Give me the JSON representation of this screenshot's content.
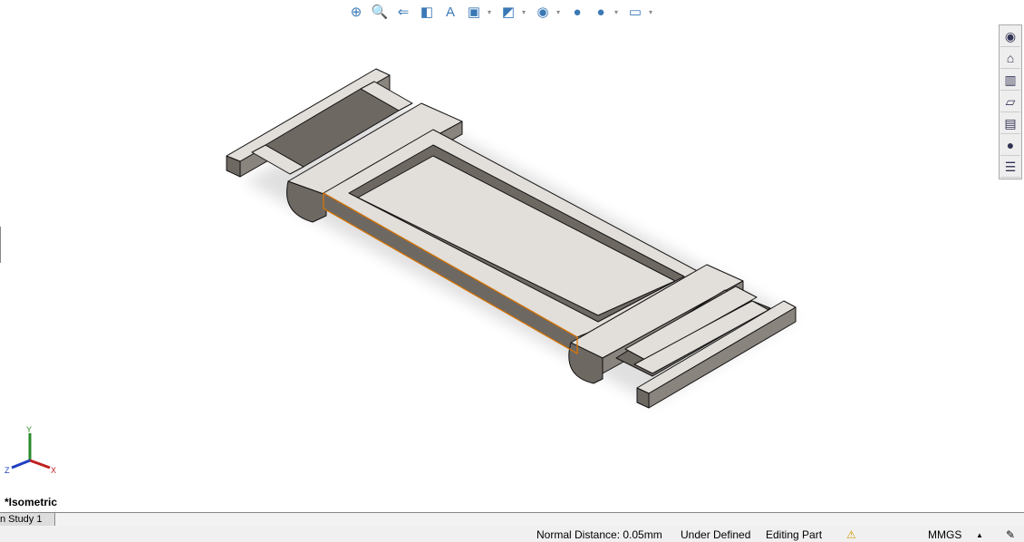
{
  "hud_toolbar": {
    "items": [
      {
        "icon": "zoom-to-fit-icon",
        "glyph": "⊕"
      },
      {
        "icon": "zoom-to-area-icon",
        "glyph": "🔍"
      },
      {
        "icon": "previous-view-icon",
        "glyph": "⇐"
      },
      {
        "icon": "section-view-icon",
        "glyph": "◧"
      },
      {
        "icon": "dynamic-annotation-icon",
        "glyph": "A"
      },
      {
        "icon": "view-orientation-icon",
        "glyph": "▣",
        "dropdown": true
      },
      {
        "icon": "display-style-icon",
        "glyph": "◩",
        "dropdown": true
      },
      {
        "icon": "hide-show-items-icon",
        "glyph": "◉",
        "dropdown": true
      },
      {
        "icon": "edit-appearance-icon",
        "glyph": "●"
      },
      {
        "icon": "apply-scene-icon",
        "glyph": "●",
        "dropdown": true
      },
      {
        "icon": "view-settings-icon",
        "glyph": "▭",
        "dropdown": true
      }
    ]
  },
  "task_pane": {
    "items": [
      {
        "icon": "solidworks-resources-icon",
        "glyph": "◉"
      },
      {
        "icon": "home-icon",
        "glyph": "⌂"
      },
      {
        "icon": "design-library-icon",
        "glyph": "▥"
      },
      {
        "icon": "file-explorer-icon",
        "glyph": "▱"
      },
      {
        "icon": "view-palette-icon",
        "glyph": "▤"
      },
      {
        "icon": "appearances-icon",
        "glyph": "●"
      },
      {
        "icon": "custom-properties-icon",
        "glyph": "☰"
      }
    ]
  },
  "triad": {
    "x": "X",
    "y": "Y",
    "z": "Z"
  },
  "view_name": "*Isometric",
  "tabs": [
    {
      "label": "n Study 1"
    }
  ],
  "status": {
    "normal_distance": "Normal Distance: 0.05mm",
    "definition": "Under Defined",
    "mode": "Editing Part",
    "units": "MMGS",
    "units_arrow": "▲"
  },
  "colors": {
    "model_face": "#e2ded9",
    "model_side": "#6e6863",
    "selected_edge": "#e07800"
  }
}
